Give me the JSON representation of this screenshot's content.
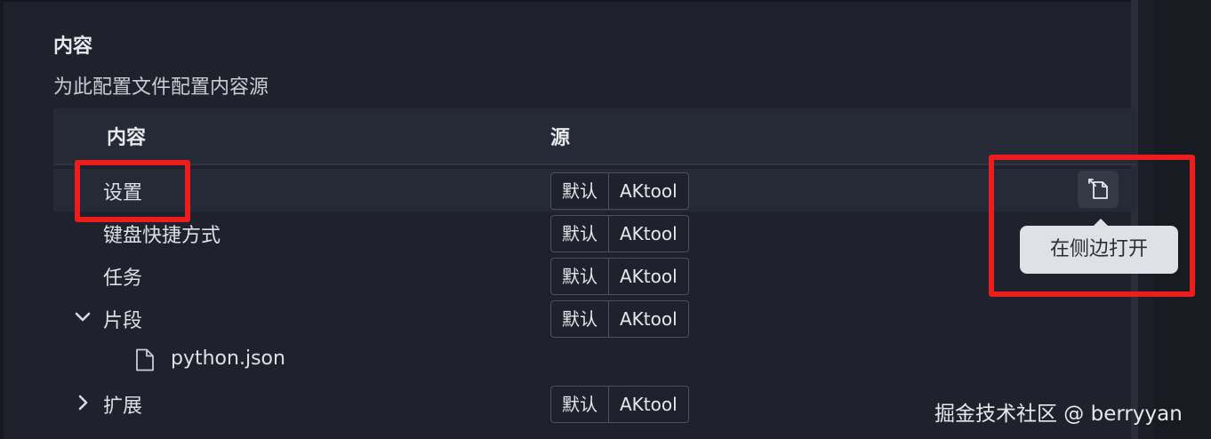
{
  "section": {
    "title": "内容",
    "description": "为此配置文件配置内容源"
  },
  "table": {
    "headers": {
      "content": "内容",
      "source": "源"
    },
    "rows": [
      {
        "label": "设置",
        "expander": "",
        "selected": true,
        "sources": [
          "默认",
          "AKtool"
        ]
      },
      {
        "label": "键盘快捷方式",
        "expander": "",
        "selected": false,
        "sources": [
          "默认",
          "AKtool"
        ]
      },
      {
        "label": "任务",
        "expander": "",
        "selected": false,
        "sources": [
          "默认",
          "AKtool"
        ]
      },
      {
        "label": "片段",
        "expander": "expanded",
        "selected": false,
        "sources": [
          "默认",
          "AKtool"
        ]
      },
      {
        "label": "python.json",
        "expander": "",
        "selected": false,
        "icon": "file-icon",
        "sources": []
      },
      {
        "label": "扩展",
        "expander": "collapsed",
        "selected": false,
        "sources": [
          "默认",
          "AKtool"
        ]
      }
    ]
  },
  "row_actions": {
    "open_side_icon": "open-in-side-icon",
    "tooltip": "在侧边打开"
  },
  "watermark": "掘金技术社区 @ berryyan",
  "colors": {
    "background": "#1f222d",
    "selected_row": "#262a36",
    "highlight": "#ee1c1c",
    "tooltip_bg": "#dfe1e6"
  }
}
